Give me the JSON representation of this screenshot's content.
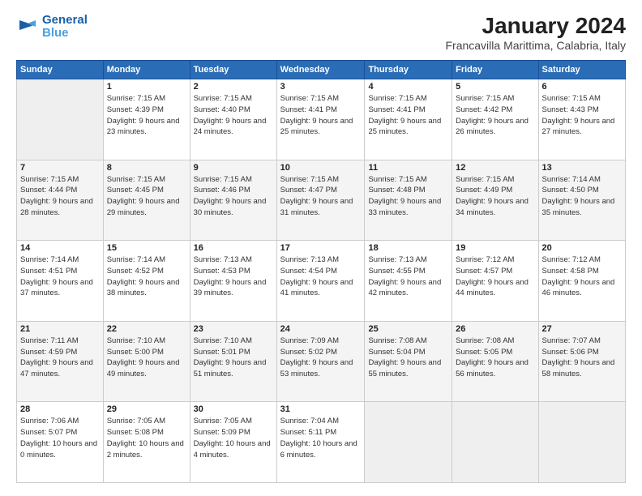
{
  "header": {
    "logo_line1": "General",
    "logo_line2": "Blue",
    "month": "January 2024",
    "location": "Francavilla Marittima, Calabria, Italy"
  },
  "weekdays": [
    "Sunday",
    "Monday",
    "Tuesday",
    "Wednesday",
    "Thursday",
    "Friday",
    "Saturday"
  ],
  "weeks": [
    [
      {
        "day": "",
        "sunrise": "",
        "sunset": "",
        "daylight": "",
        "empty": true
      },
      {
        "day": "1",
        "sunrise": "7:15 AM",
        "sunset": "4:39 PM",
        "daylight": "9 hours and 23 minutes."
      },
      {
        "day": "2",
        "sunrise": "7:15 AM",
        "sunset": "4:40 PM",
        "daylight": "9 hours and 24 minutes."
      },
      {
        "day": "3",
        "sunrise": "7:15 AM",
        "sunset": "4:41 PM",
        "daylight": "9 hours and 25 minutes."
      },
      {
        "day": "4",
        "sunrise": "7:15 AM",
        "sunset": "4:41 PM",
        "daylight": "9 hours and 25 minutes."
      },
      {
        "day": "5",
        "sunrise": "7:15 AM",
        "sunset": "4:42 PM",
        "daylight": "9 hours and 26 minutes."
      },
      {
        "day": "6",
        "sunrise": "7:15 AM",
        "sunset": "4:43 PM",
        "daylight": "9 hours and 27 minutes."
      }
    ],
    [
      {
        "day": "7",
        "sunrise": "7:15 AM",
        "sunset": "4:44 PM",
        "daylight": "9 hours and 28 minutes."
      },
      {
        "day": "8",
        "sunrise": "7:15 AM",
        "sunset": "4:45 PM",
        "daylight": "9 hours and 29 minutes."
      },
      {
        "day": "9",
        "sunrise": "7:15 AM",
        "sunset": "4:46 PM",
        "daylight": "9 hours and 30 minutes."
      },
      {
        "day": "10",
        "sunrise": "7:15 AM",
        "sunset": "4:47 PM",
        "daylight": "9 hours and 31 minutes."
      },
      {
        "day": "11",
        "sunrise": "7:15 AM",
        "sunset": "4:48 PM",
        "daylight": "9 hours and 33 minutes."
      },
      {
        "day": "12",
        "sunrise": "7:15 AM",
        "sunset": "4:49 PM",
        "daylight": "9 hours and 34 minutes."
      },
      {
        "day": "13",
        "sunrise": "7:14 AM",
        "sunset": "4:50 PM",
        "daylight": "9 hours and 35 minutes."
      }
    ],
    [
      {
        "day": "14",
        "sunrise": "7:14 AM",
        "sunset": "4:51 PM",
        "daylight": "9 hours and 37 minutes."
      },
      {
        "day": "15",
        "sunrise": "7:14 AM",
        "sunset": "4:52 PM",
        "daylight": "9 hours and 38 minutes."
      },
      {
        "day": "16",
        "sunrise": "7:13 AM",
        "sunset": "4:53 PM",
        "daylight": "9 hours and 39 minutes."
      },
      {
        "day": "17",
        "sunrise": "7:13 AM",
        "sunset": "4:54 PM",
        "daylight": "9 hours and 41 minutes."
      },
      {
        "day": "18",
        "sunrise": "7:13 AM",
        "sunset": "4:55 PM",
        "daylight": "9 hours and 42 minutes."
      },
      {
        "day": "19",
        "sunrise": "7:12 AM",
        "sunset": "4:57 PM",
        "daylight": "9 hours and 44 minutes."
      },
      {
        "day": "20",
        "sunrise": "7:12 AM",
        "sunset": "4:58 PM",
        "daylight": "9 hours and 46 minutes."
      }
    ],
    [
      {
        "day": "21",
        "sunrise": "7:11 AM",
        "sunset": "4:59 PM",
        "daylight": "9 hours and 47 minutes."
      },
      {
        "day": "22",
        "sunrise": "7:10 AM",
        "sunset": "5:00 PM",
        "daylight": "9 hours and 49 minutes."
      },
      {
        "day": "23",
        "sunrise": "7:10 AM",
        "sunset": "5:01 PM",
        "daylight": "9 hours and 51 minutes."
      },
      {
        "day": "24",
        "sunrise": "7:09 AM",
        "sunset": "5:02 PM",
        "daylight": "9 hours and 53 minutes."
      },
      {
        "day": "25",
        "sunrise": "7:08 AM",
        "sunset": "5:04 PM",
        "daylight": "9 hours and 55 minutes."
      },
      {
        "day": "26",
        "sunrise": "7:08 AM",
        "sunset": "5:05 PM",
        "daylight": "9 hours and 56 minutes."
      },
      {
        "day": "27",
        "sunrise": "7:07 AM",
        "sunset": "5:06 PM",
        "daylight": "9 hours and 58 minutes."
      }
    ],
    [
      {
        "day": "28",
        "sunrise": "7:06 AM",
        "sunset": "5:07 PM",
        "daylight": "10 hours and 0 minutes."
      },
      {
        "day": "29",
        "sunrise": "7:05 AM",
        "sunset": "5:08 PM",
        "daylight": "10 hours and 2 minutes."
      },
      {
        "day": "30",
        "sunrise": "7:05 AM",
        "sunset": "5:09 PM",
        "daylight": "10 hours and 4 minutes."
      },
      {
        "day": "31",
        "sunrise": "7:04 AM",
        "sunset": "5:11 PM",
        "daylight": "10 hours and 6 minutes."
      },
      {
        "day": "",
        "sunrise": "",
        "sunset": "",
        "daylight": "",
        "empty": true
      },
      {
        "day": "",
        "sunrise": "",
        "sunset": "",
        "daylight": "",
        "empty": true
      },
      {
        "day": "",
        "sunrise": "",
        "sunset": "",
        "daylight": "",
        "empty": true
      }
    ]
  ],
  "labels": {
    "sunrise_prefix": "Sunrise: ",
    "sunset_prefix": "Sunset: ",
    "daylight_prefix": "Daylight: "
  }
}
